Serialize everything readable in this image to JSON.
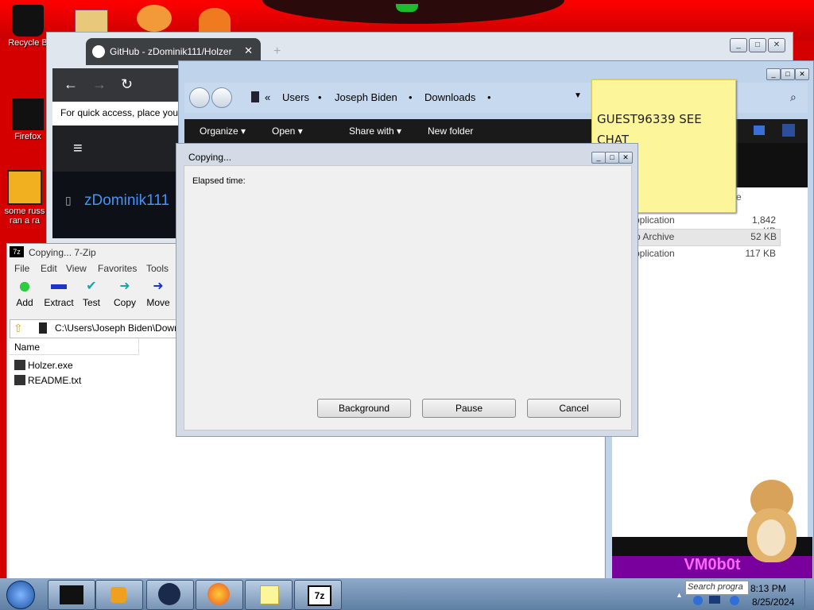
{
  "desktop": {
    "icons": [
      {
        "label": "Recycle B"
      },
      {
        "label": "Firefox"
      },
      {
        "label": "some russ ran a ra"
      }
    ]
  },
  "browser": {
    "tab_title": "GitHub - zDominik111/Holzer",
    "tab_close": "✕",
    "new_tab": "+",
    "quick_access_text": "For quick access, place your",
    "repo_owner": "zDominik111"
  },
  "explorer": {
    "breadcrumb": [
      "Users",
      "Joseph Biden",
      "Downloads"
    ],
    "breadcrumb_prefix": "«",
    "commands": {
      "organize": "Organize ▾",
      "open": "Open ▾",
      "share": "Share with ▾",
      "new_folder": "New folder"
    },
    "files": [
      {
        "type": "pplication",
        "size": "1,842 KB"
      },
      {
        "type": "p Archive",
        "size": "52 KB"
      },
      {
        "type": "pplication",
        "size": "117 KB"
      }
    ],
    "column_fragment": "e"
  },
  "sticky_note": {
    "text": "GUEST96339 SEE CHAT"
  },
  "zip": {
    "title": "Copying... 7-Zip",
    "menu": [
      "File",
      "Edit",
      "View",
      "Favorites",
      "Tools"
    ],
    "toolbar": [
      "Add",
      "Extract",
      "Test",
      "Copy",
      "Move"
    ],
    "path": "C:\\Users\\Joseph Biden\\Down",
    "column_name": "Name",
    "files": [
      "Holzer.exe",
      "README.txt"
    ]
  },
  "copy_dialog": {
    "title": "Copying...",
    "elapsed_label": "Elapsed time:",
    "buttons": {
      "background": "Background",
      "pause": "Pause",
      "cancel": "Cancel"
    }
  },
  "taskbar": {
    "search_placeholder": "Search progra",
    "time": "8:13 PM",
    "date": "8/25/2024"
  },
  "banner_text": "VM0b0t",
  "colors": {
    "desktop": "#d40000",
    "sticky": "#fdf59a",
    "accent": "#1b4f9e"
  }
}
